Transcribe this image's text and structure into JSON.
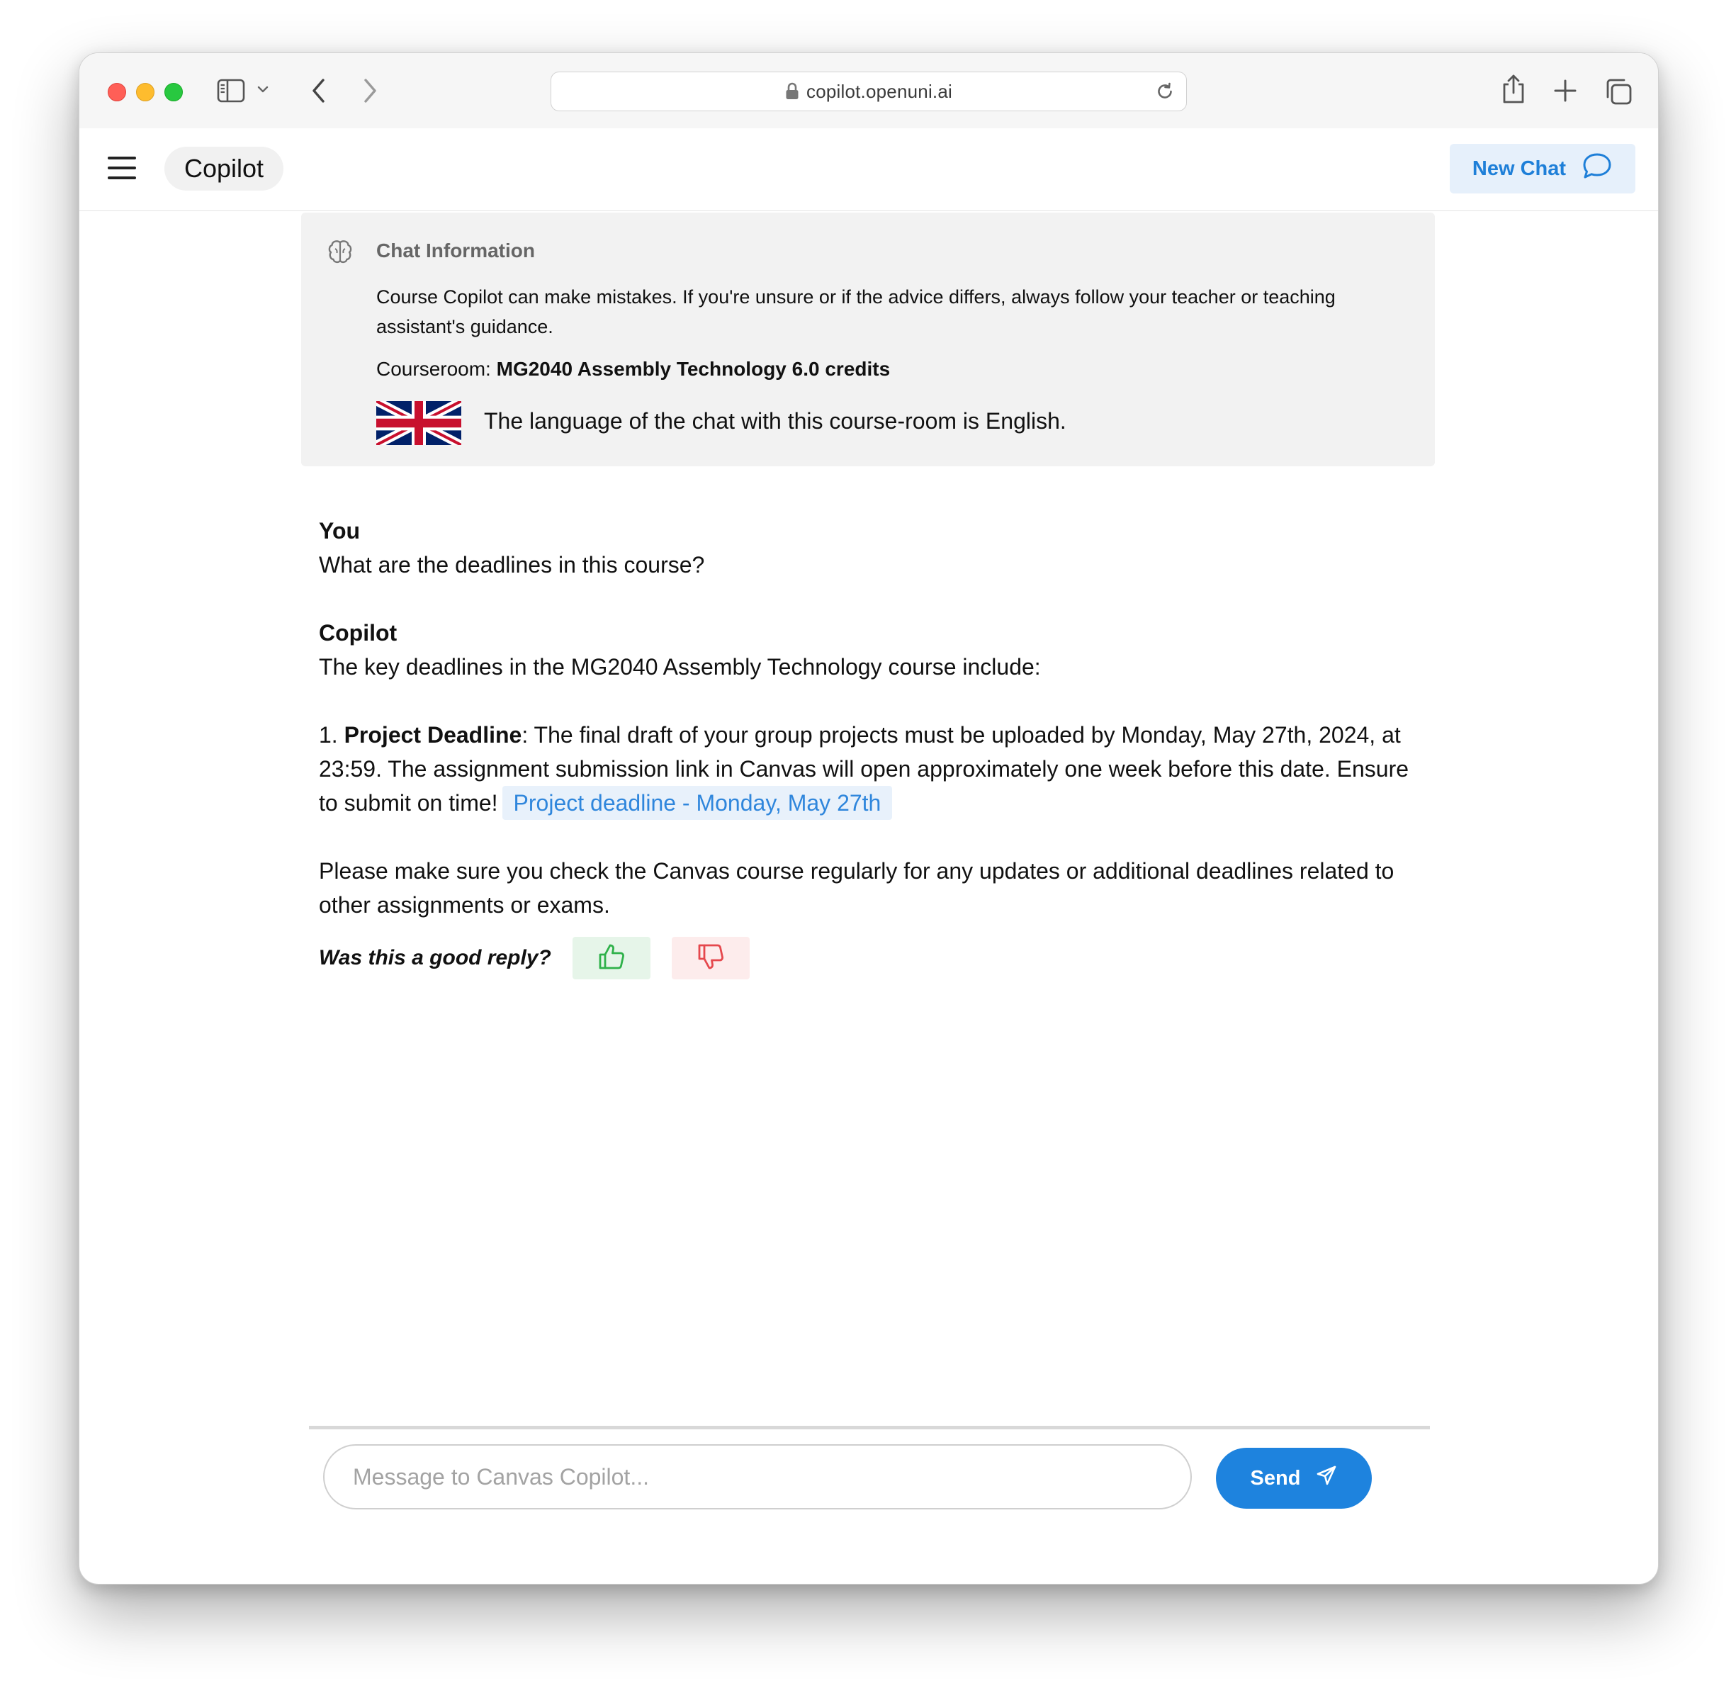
{
  "browser": {
    "url": "copilot.openuni.ai"
  },
  "header": {
    "brand": "Copilot",
    "new_chat_label": "New Chat"
  },
  "chat_info": {
    "title": "Chat Information",
    "description": "Course Copilot can make mistakes. If you're unsure or if the advice differs, always follow your teacher or teaching assistant's guidance.",
    "courseroom_label": "Courseroom:",
    "courseroom_name": "MG2040 Assembly Technology 6.0 credits",
    "language_text": "The language of the chat with this course-room is English."
  },
  "conversation": {
    "user_name": "You",
    "user_message": "What are the deadlines in this course?",
    "assistant_name": "Copilot",
    "assistant_intro": "The key deadlines in the MG2040 Assembly Technology course include:",
    "item_number": "1.",
    "item_title": "Project Deadline",
    "item_text": ": The final draft of your group projects must be uploaded by Monday, May 27th, 2024, at 23:59. The assignment submission link in Canvas will open approximately one week before this date. Ensure to submit on time!",
    "deadline_link": "Project deadline - Monday, May 27th",
    "closing": "Please make sure you check the Canvas course regularly for any updates or additional deadlines related to other assignments or exams."
  },
  "feedback": {
    "question": "Was this a good reply?"
  },
  "composer": {
    "placeholder": "Message to Canvas Copilot...",
    "value": "",
    "send_label": "Send"
  },
  "colors": {
    "accent": "#1e83de",
    "link_bg": "#e8f1fb",
    "thumb_up": "#2fb14a",
    "thumb_down": "#e5484d"
  },
  "icons": {
    "sidebar": "sidebar-icon",
    "back": "chevron-left-icon",
    "forward": "chevron-right-icon",
    "lock": "lock-icon",
    "reload": "reload-icon",
    "share": "share-icon",
    "new_tab": "plus-icon",
    "tabs": "tabs-icon",
    "menu": "hamburger-icon",
    "new_chat": "chat-bubble-icon",
    "info": "brain-icon",
    "flag": "uk-flag-icon",
    "like": "thumbs-up-icon",
    "dislike": "thumbs-down-icon",
    "send": "paper-plane-icon"
  }
}
